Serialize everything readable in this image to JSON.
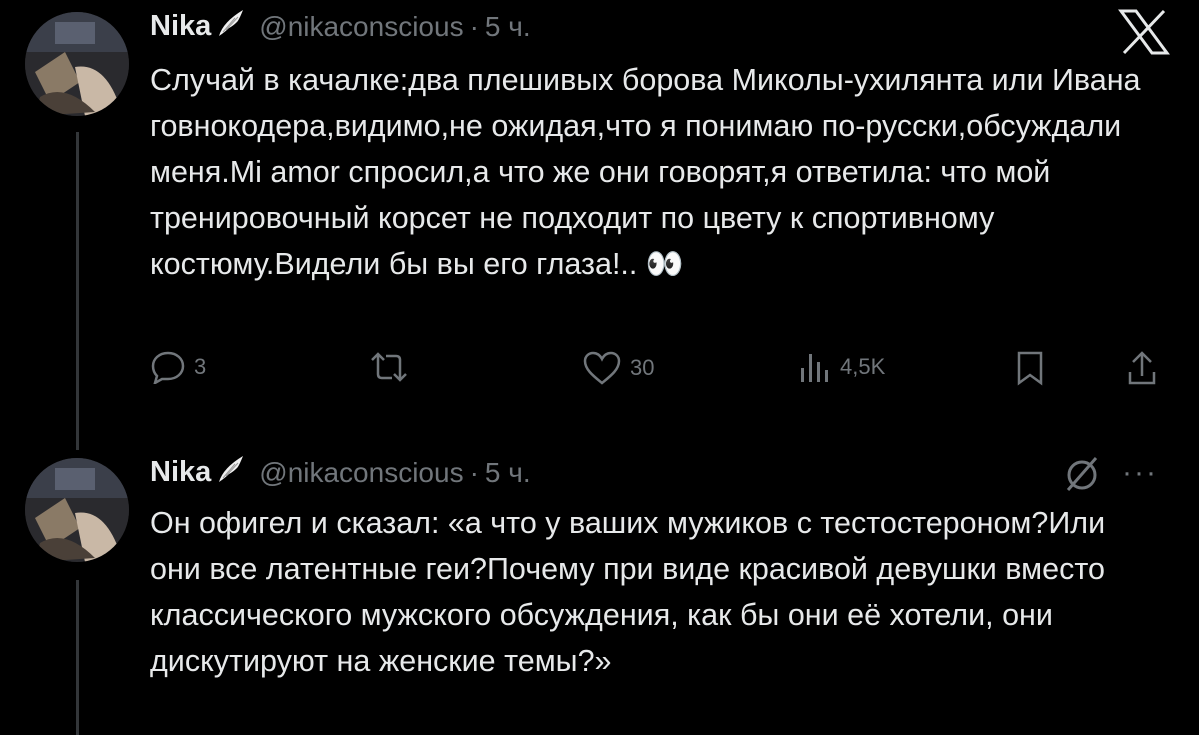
{
  "tweets": [
    {
      "name": "Nika",
      "handle": "@nikaconscious",
      "separator": "·",
      "time": "5 ч.",
      "text": "Случай в качалке:два плешивых борова Миколы-ухилянта или Ивана говнокодера,видимо,не ожидая,что я понимаю по-русски,обсуждали меня.Mi amor спросил,а что же они говорят,я ответила: что мой тренировочный корсет не подходит по цвету к спортивному костюму.Видели бы вы его глаза!..",
      "emoji": "👀",
      "actions": {
        "replies": "3",
        "retweets": "",
        "likes": "30",
        "views": "4,5K"
      }
    },
    {
      "name": "Nika",
      "handle": "@nikaconscious",
      "separator": "·",
      "time": "5 ч.",
      "text": "Он офигел и сказал: «а что у ваших мужиков с тестостероном?Или они все латентные геи?Почему при виде красивой девушки вместо классического мужского обсуждения, как бы они её хотели, они дискутируют на женские темы?»"
    }
  ],
  "icons": {
    "top_right": "x-logo-icon",
    "second_right": "grok-icon",
    "more": "···"
  },
  "colors": {
    "background": "#000000",
    "text": "#e7e9ea",
    "secondary": "#71767b"
  }
}
